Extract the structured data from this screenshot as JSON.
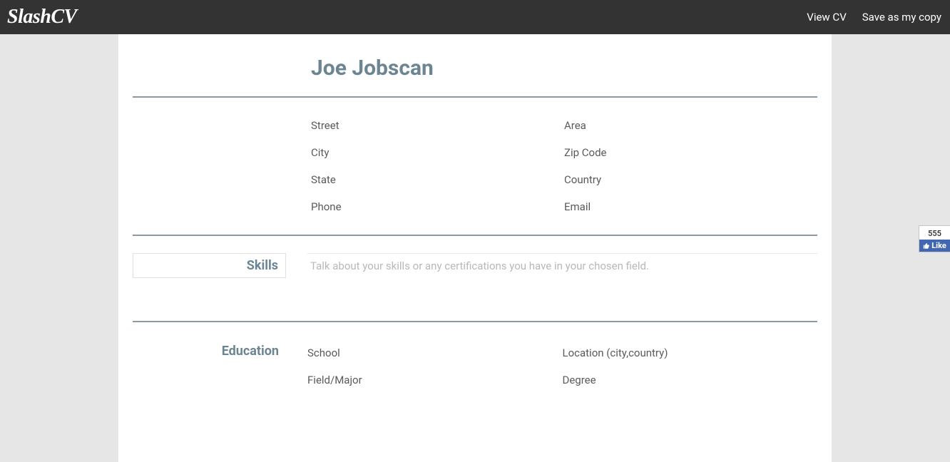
{
  "header": {
    "logo": "SlashCV",
    "view_cv": "View CV",
    "save_copy": "Save as my copy"
  },
  "cv": {
    "name": "Joe Jobscan",
    "contact": {
      "left": [
        "Street",
        "City",
        "State",
        "Phone"
      ],
      "right": [
        "Area",
        "Zip Code",
        "Country",
        "Email"
      ]
    },
    "skills": {
      "label": "Skills",
      "placeholder": "Talk about your skills or any certifications you have in your chosen field."
    },
    "education": {
      "label": "Education",
      "left": [
        "School",
        "Field/Major"
      ],
      "right": [
        "Location (city,country)",
        "Degree"
      ]
    }
  },
  "fb": {
    "count": "555",
    "like": "Like"
  }
}
